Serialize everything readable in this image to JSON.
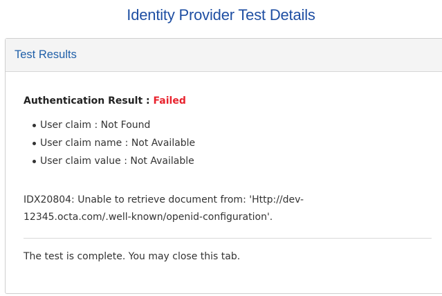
{
  "page": {
    "title": "Identity Provider Test Details"
  },
  "panel": {
    "header_title": "Test Results"
  },
  "result": {
    "label": "Authentication Result : ",
    "status": "Failed",
    "status_color": "#e8222d"
  },
  "claims": [
    {
      "text": "User claim : Not Found"
    },
    {
      "text": "User claim name : Not Available"
    },
    {
      "text": "User claim value : Not Available"
    }
  ],
  "error": {
    "line1": "IDX20804: Unable to retrieve document from: 'Http://dev-",
    "line2": "12345.octa.com/.well-known/openid-configuration'."
  },
  "footer": {
    "message": "The test is complete. You may close this tab."
  },
  "colors": {
    "title_blue": "#1f4fa3",
    "header_blue": "#1f5fa8",
    "header_bg": "#f4f4f4"
  }
}
